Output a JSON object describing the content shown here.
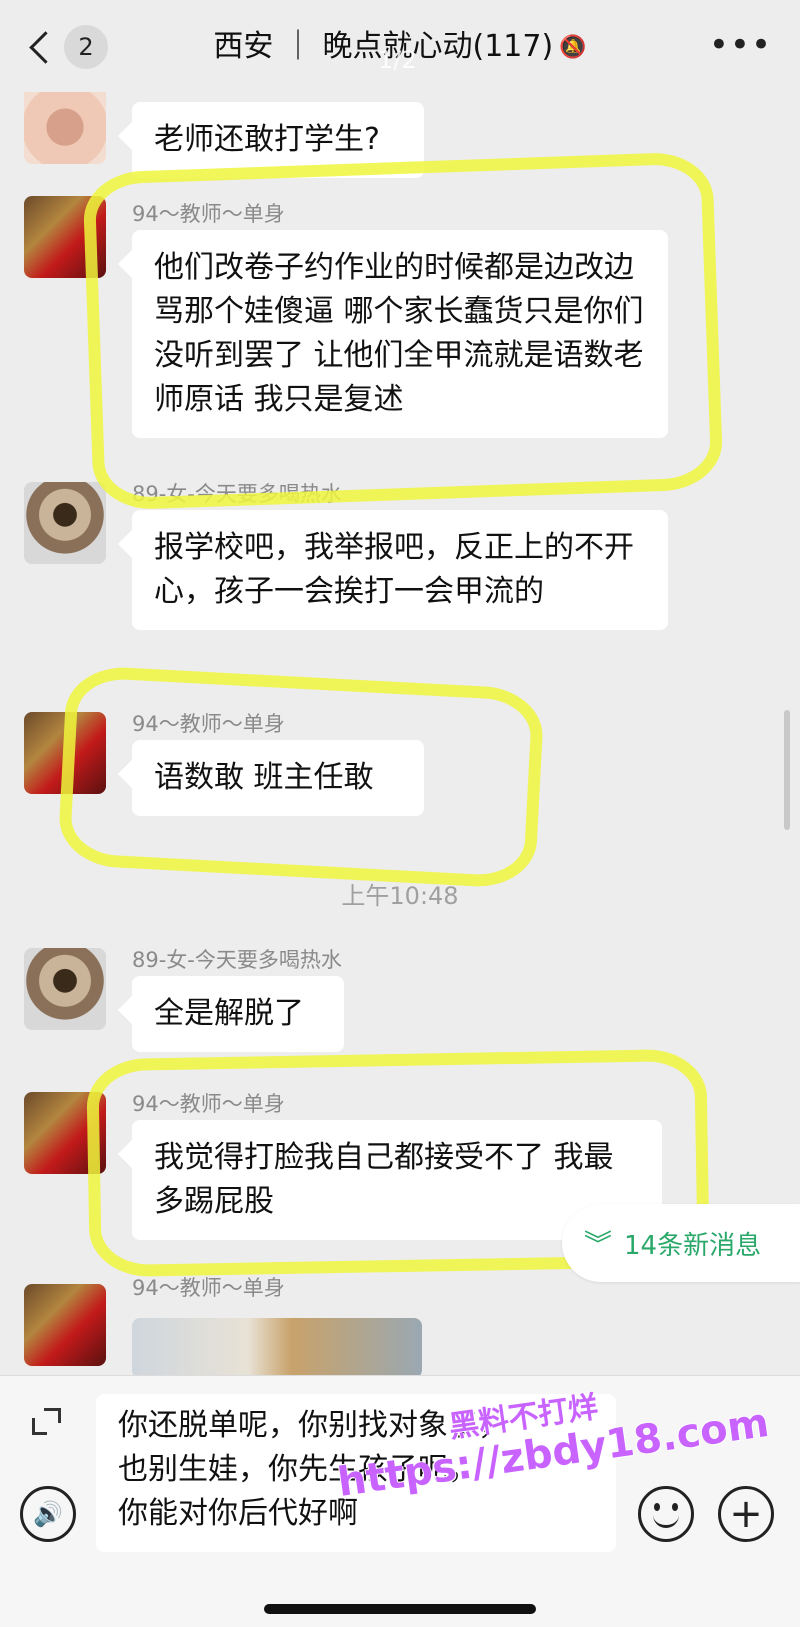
{
  "header": {
    "back_count": "2",
    "title": "西安 ｜ 晚点就心动(117)",
    "page_indicator": "1/2"
  },
  "messages": [
    {
      "sender": "",
      "text": "老师还敢打学生?"
    },
    {
      "sender": "94～教师～单身",
      "text": "他们改卷子约作业的时候都是边改边骂那个娃傻逼 哪个家长蠢货只是你们没听到罢了 让他们全甲流就是语数老师原话 我只是复述"
    },
    {
      "sender": "89-女-今天要多喝热水",
      "text": "报学校吧，我举报吧，反正上的不开心，孩子一会挨打一会甲流的"
    },
    {
      "sender": "94～教师～单身",
      "text": "语数敢 班主任敢"
    },
    {
      "sender": "89-女-今天要多喝热水",
      "text": "全是解脱了"
    },
    {
      "sender": "94～教师～单身",
      "text": "我觉得打脸我自己都接受不了 我最多踢屁股"
    },
    {
      "sender": "94～教师～单身",
      "text": ""
    }
  ],
  "timestamp": "上午10:48",
  "new_messages": "14条新消息",
  "input": {
    "value": "你还脱单呢，你别找对象了，\n也别生娃，你先生孩子呢，\n你能对你后代好啊"
  },
  "watermark": {
    "line1": "黑料不打烊",
    "line2": "https://zbdy18.com"
  },
  "colors": {
    "background": "#ededed",
    "bubble": "#ffffff",
    "highlight": "#eef63c",
    "new_messages_text": "#2aa86a"
  }
}
